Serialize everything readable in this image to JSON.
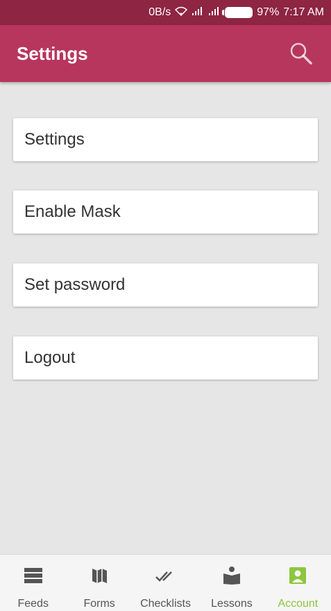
{
  "status_bar": {
    "network_speed": "0B/s",
    "battery_percent": "97%",
    "time": "7:17 AM"
  },
  "app_bar": {
    "title": "Settings",
    "search_icon": "search-icon"
  },
  "menu": {
    "items": [
      {
        "label": "Settings"
      },
      {
        "label": "Enable Mask"
      },
      {
        "label": "Set password"
      },
      {
        "label": "Logout"
      }
    ]
  },
  "bottom_nav": {
    "items": [
      {
        "label": "Feeds",
        "icon": "feeds-icon",
        "active": false
      },
      {
        "label": "Forms",
        "icon": "map-icon",
        "active": false
      },
      {
        "label": "Checklists",
        "icon": "double-check-icon",
        "active": false
      },
      {
        "label": "Lessons",
        "icon": "reader-icon",
        "active": false
      },
      {
        "label": "Account",
        "icon": "account-icon",
        "active": true
      }
    ]
  },
  "colors": {
    "status_bar": "#8e2543",
    "app_bar": "#b7365d",
    "background": "#e6e6e6",
    "active_nav": "#8cc63e",
    "inactive_nav": "#555555"
  }
}
